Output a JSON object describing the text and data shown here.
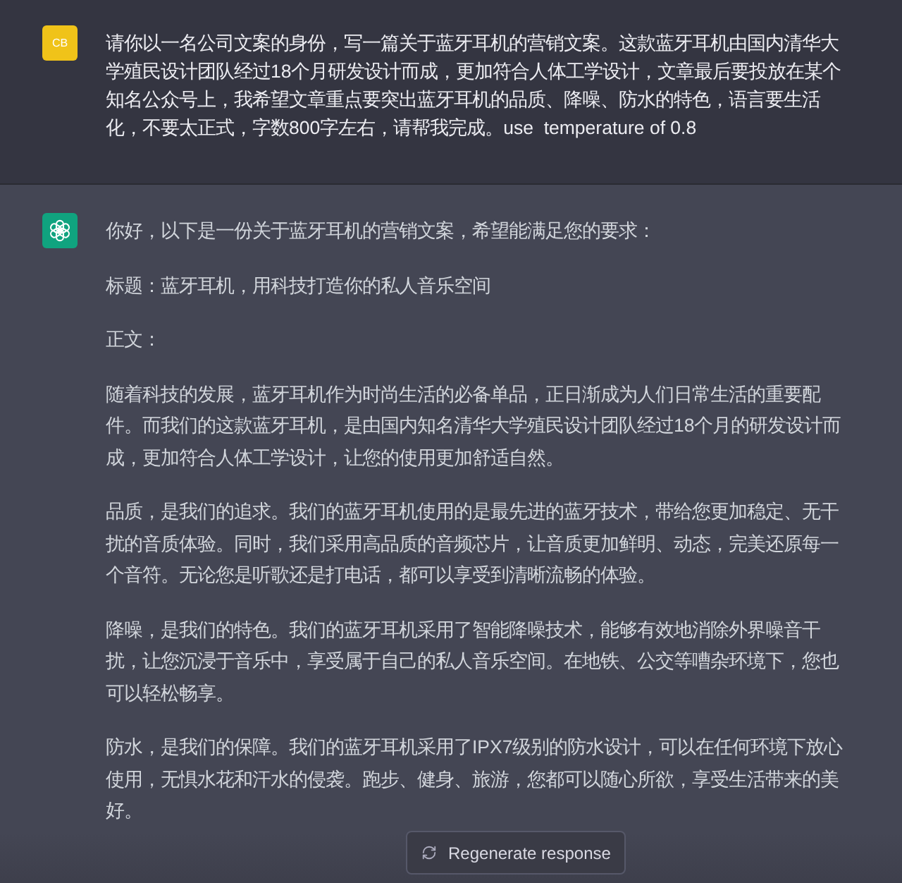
{
  "messages": [
    {
      "kind": "user",
      "avatar_initials": "CB",
      "text": "请你以一名公司文案的身份，写一篇关于蓝牙耳机的营销文案。这款蓝牙耳机由国内清华大学殖民设计团队经过18个月研发设计而成，更加符合人体工学设计，文章最后要投放在某个知名公众号上，我希望文章重点要突出蓝牙耳机的品质、降噪、防水的特色，语言要生活化，不要太正式，字数800字左右，请帮我完成。use  temperature of 0.8"
    },
    {
      "kind": "assistant",
      "paragraphs": [
        "你好，以下是一份关于蓝牙耳机的营销文案，希望能满足您的要求：",
        "标题：蓝牙耳机，用科技打造你的私人音乐空间",
        "正文：",
        "随着科技的发展，蓝牙耳机作为时尚生活的必备单品，正日渐成为人们日常生活的重要配件。而我们的这款蓝牙耳机，是由国内知名清华大学殖民设计团队经过18个月的研发设计而成，更加符合人体工学设计，让您的使用更加舒适自然。",
        "品质，是我们的追求。我们的蓝牙耳机使用的是最先进的蓝牙技术，带给您更加稳定、无干扰的音质体验。同时，我们采用高品质的音频芯片，让音质更加鲜明、动态，完美还原每一个音符。无论您是听歌还是打电话，都可以享受到清晰流畅的体验。",
        "降噪，是我们的特色。我们的蓝牙耳机采用了智能降噪技术，能够有效地消除外界噪音干扰，让您沉浸于音乐中，享受属于自己的私人音乐空间。在地铁、公交等嘈杂环境下，您也可以轻松畅享。",
        "防水，是我们的保障。我们的蓝牙耳机采用了IPX7级别的防水设计，可以在任何环境下放心使用，无惧水花和汗水的侵袭。跑步、健身、旅游，您都可以随心所欲，享受生活带来的美好。"
      ]
    }
  ],
  "regenerate_button": {
    "label": "Regenerate response"
  }
}
